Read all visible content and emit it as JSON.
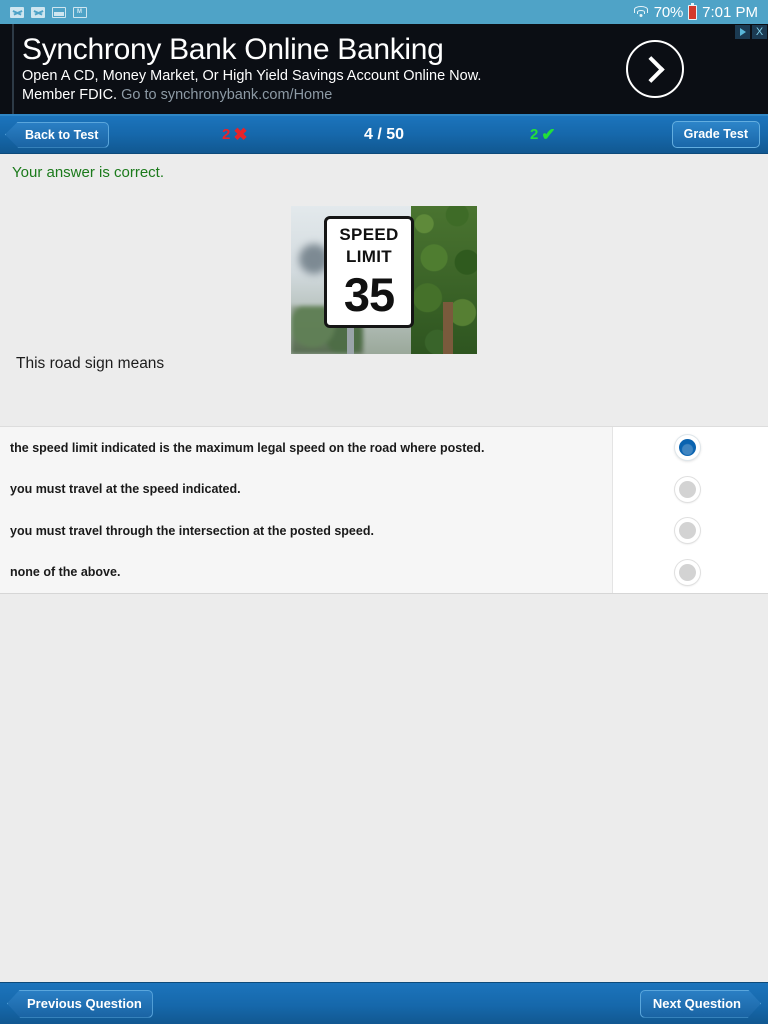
{
  "statusbar": {
    "icons": [
      "envelope-icon",
      "envelope-icon",
      "photo-icon",
      "mail-app-icon"
    ],
    "wifi_icon": "wifi-icon",
    "battery_percent": "70%",
    "battery_icon": "battery-low-icon",
    "time": "7:01 PM"
  },
  "ad": {
    "title": "Synchrony Bank Online Banking",
    "line1": "Open A CD, Money Market, Or High Yield Savings Account Online Now.",
    "line2_bold": "Member FDIC.",
    "line2_url": "Go to synchronybank.com/Home",
    "cta_icon": "chevron-right-icon",
    "adchoices_icon": "adchoices-icon",
    "close_label": "X"
  },
  "header": {
    "back_label": "Back to Test",
    "wrong_count": "2",
    "wrong_mark": "✖",
    "question_progress": "4 / 50",
    "right_count": "2",
    "right_mark": "✔",
    "grade_label": "Grade Test",
    "wrong_color": "#e8232a",
    "right_color": "#22e03a",
    "bar_color": "#1668ab"
  },
  "question": {
    "feedback": "Your answer is correct.",
    "feedback_color": "#1b7a1b",
    "image_alt": "speed-limit-35-road-sign-photo",
    "sign_line1": "SPEED",
    "sign_line2": "LIMIT",
    "sign_number": "35",
    "prompt": "This road sign means"
  },
  "answers": {
    "options": [
      {
        "text": "the speed limit indicated is the maximum legal speed on the road where posted.",
        "selected": true
      },
      {
        "text": "you must travel at the speed indicated.",
        "selected": false
      },
      {
        "text": "you must travel through the intersection at the posted speed.",
        "selected": false
      },
      {
        "text": "none of the above.",
        "selected": false
      }
    ],
    "selected_color": "#0a63b0"
  },
  "footer": {
    "previous_label": "Previous Question",
    "next_label": "Next Question"
  }
}
